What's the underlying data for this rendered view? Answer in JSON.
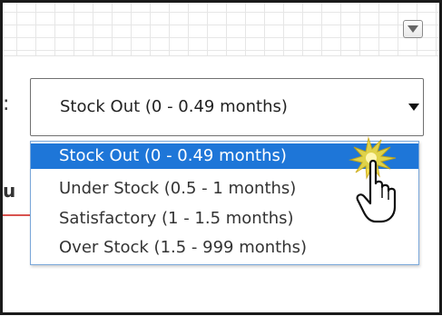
{
  "header": {
    "panel_toggle_icon": "chevron-down-icon"
  },
  "filter": {
    "label_tail": ":",
    "selected_value": "Stock Out (0 - 0.49 months)",
    "arrow_icon": "triangle-down-icon"
  },
  "background": {
    "fragment_text": "u"
  },
  "dropdown": {
    "options": [
      {
        "label": "Stock Out (0 - 0.49 months)",
        "selected": true
      },
      {
        "label": "Under Stock (0.5 - 1 months)",
        "selected": false
      },
      {
        "label": "Satisfactory (1 - 1.5 months)",
        "selected": false
      },
      {
        "label": "Over Stock (1.5 - 999 months)",
        "selected": false
      }
    ],
    "highlight_color": "#1e76d8"
  },
  "pointer": {
    "icon": "hand-pointer-icon",
    "click_glow_color": "#f2d21b"
  }
}
